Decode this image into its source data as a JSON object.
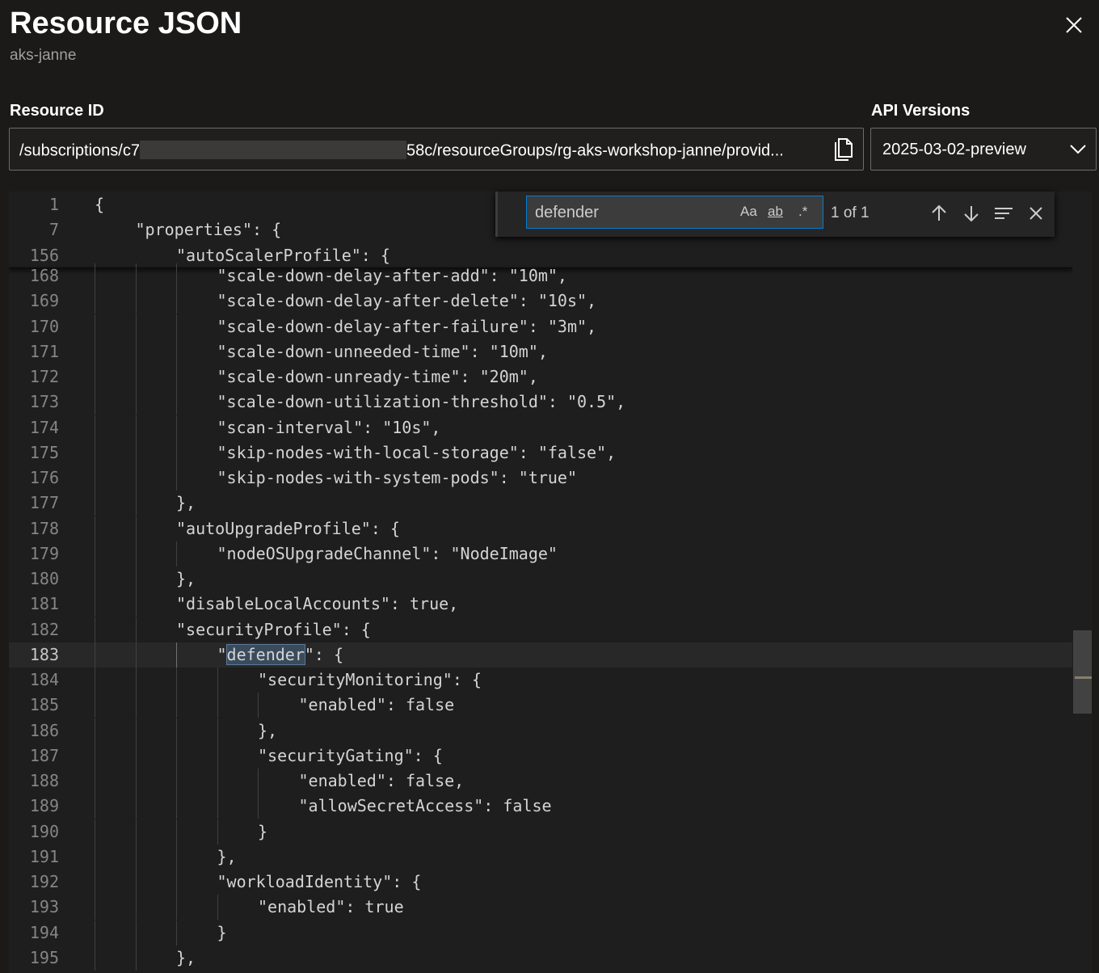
{
  "header": {
    "title": "Resource JSON",
    "subtitle": "aks-janne"
  },
  "resource_id": {
    "label": "Resource ID",
    "value_start": "/subscriptions/c7",
    "value_end": "58c/resourceGroups/rg-aks-workshop-janne/provid..."
  },
  "api_versions": {
    "label": "API Versions",
    "selected": "2025-03-02-preview"
  },
  "find": {
    "query": "defender",
    "match_case_label": "Aa",
    "whole_word_label": "ab",
    "regex_label": ".*",
    "count": "1 of 1"
  },
  "sticky_lines": [
    {
      "num": "1",
      "text": "{",
      "indent": 0
    },
    {
      "num": "7",
      "text": "\"properties\": {",
      "indent": 1
    },
    {
      "num": "156",
      "text": "\"autoScalerProfile\": {",
      "indent": 2
    }
  ],
  "lines": [
    {
      "num": "168",
      "text": "\"scale-down-delay-after-add\": \"10m\",",
      "indent": 3
    },
    {
      "num": "169",
      "text": "\"scale-down-delay-after-delete\": \"10s\",",
      "indent": 3
    },
    {
      "num": "170",
      "text": "\"scale-down-delay-after-failure\": \"3m\",",
      "indent": 3
    },
    {
      "num": "171",
      "text": "\"scale-down-unneeded-time\": \"10m\",",
      "indent": 3
    },
    {
      "num": "172",
      "text": "\"scale-down-unready-time\": \"20m\",",
      "indent": 3
    },
    {
      "num": "173",
      "text": "\"scale-down-utilization-threshold\": \"0.5\",",
      "indent": 3
    },
    {
      "num": "174",
      "text": "\"scan-interval\": \"10s\",",
      "indent": 3
    },
    {
      "num": "175",
      "text": "\"skip-nodes-with-local-storage\": \"false\",",
      "indent": 3
    },
    {
      "num": "176",
      "text": "\"skip-nodes-with-system-pods\": \"true\"",
      "indent": 3
    },
    {
      "num": "177",
      "text": "},",
      "indent": 2
    },
    {
      "num": "178",
      "text": "\"autoUpgradeProfile\": {",
      "indent": 2
    },
    {
      "num": "179",
      "text": "\"nodeOSUpgradeChannel\": \"NodeImage\"",
      "indent": 3
    },
    {
      "num": "180",
      "text": "},",
      "indent": 2
    },
    {
      "num": "181",
      "text": "\"disableLocalAccounts\": true,",
      "indent": 2
    },
    {
      "num": "182",
      "text": "\"securityProfile\": {",
      "indent": 2
    },
    {
      "num": "183",
      "text": "\"defender\": {",
      "indent": 3
    },
    {
      "num": "184",
      "text": "\"securityMonitoring\": {",
      "indent": 4
    },
    {
      "num": "185",
      "text": "\"enabled\": false",
      "indent": 5
    },
    {
      "num": "186",
      "text": "},",
      "indent": 4
    },
    {
      "num": "187",
      "text": "\"securityGating\": {",
      "indent": 4
    },
    {
      "num": "188",
      "text": "\"enabled\": false,",
      "indent": 5
    },
    {
      "num": "189",
      "text": "\"allowSecretAccess\": false",
      "indent": 5
    },
    {
      "num": "190",
      "text": "}",
      "indent": 4
    },
    {
      "num": "191",
      "text": "},",
      "indent": 3
    },
    {
      "num": "192",
      "text": "\"workloadIdentity\": {",
      "indent": 3
    },
    {
      "num": "193",
      "text": "\"enabled\": true",
      "indent": 4
    },
    {
      "num": "194",
      "text": "}",
      "indent": 3
    },
    {
      "num": "195",
      "text": "},",
      "indent": 2
    }
  ],
  "current_line": "183",
  "colors": {
    "background": "#1b1a19",
    "editor": "#1e1e1e",
    "accent": "#007fd4"
  }
}
